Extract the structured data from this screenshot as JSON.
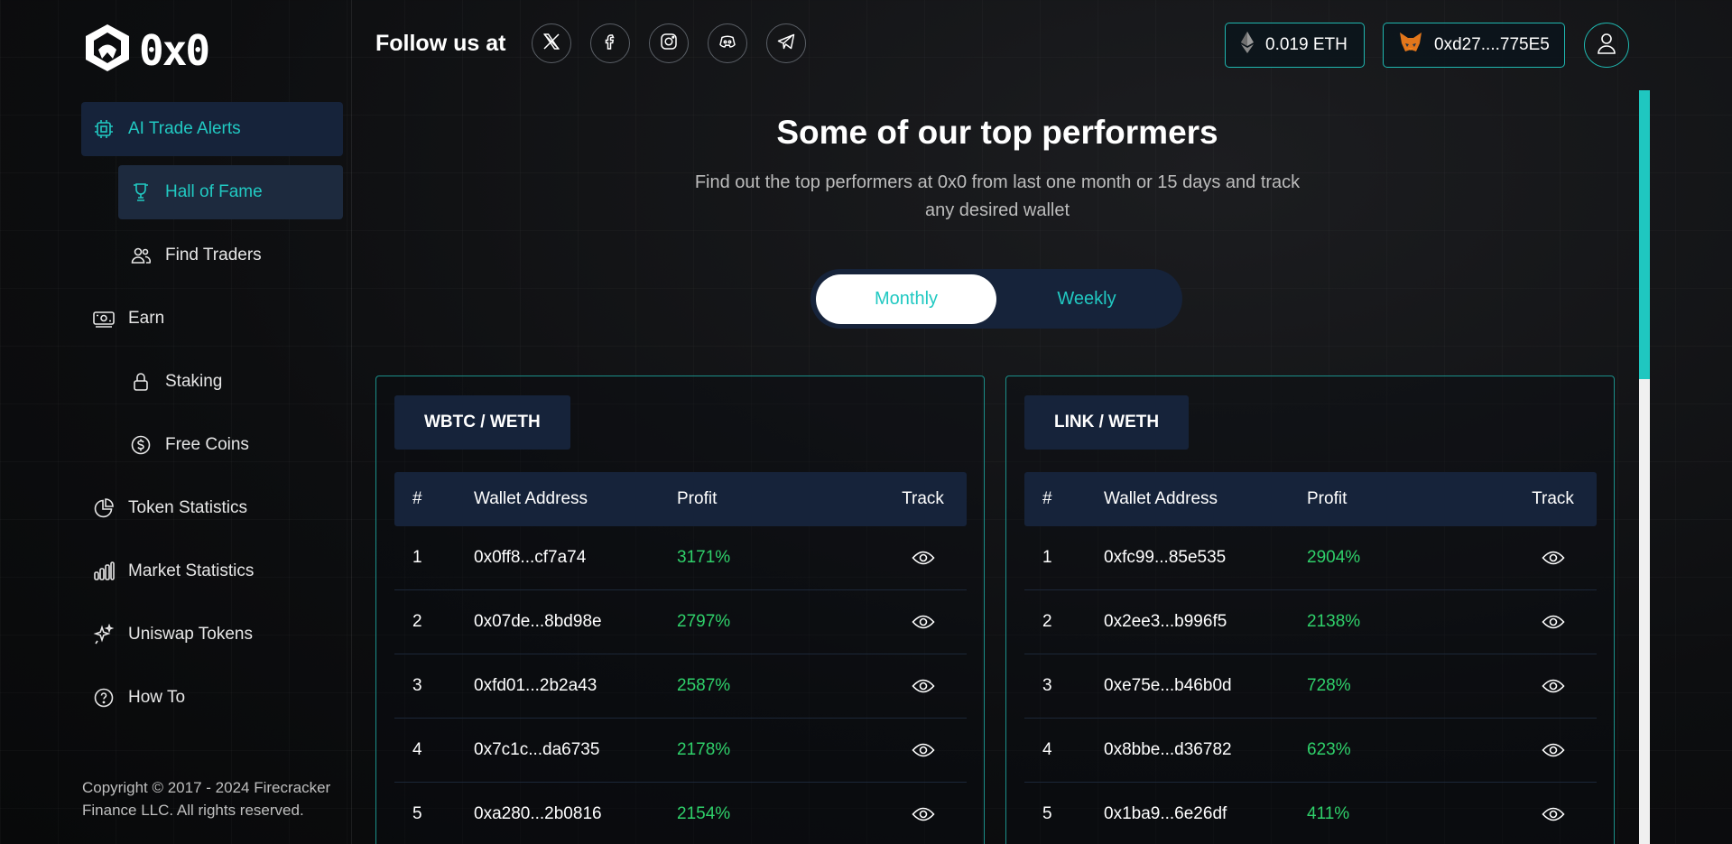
{
  "brand": {
    "name": "0x0"
  },
  "sidebar": {
    "items": [
      {
        "label": "AI Trade Alerts",
        "icon": "chip-icon",
        "state": "active"
      },
      {
        "label": "Hall of Fame",
        "icon": "trophy-icon",
        "state": "selected",
        "sub": true
      },
      {
        "label": "Find Traders",
        "icon": "users-icon",
        "sub": true
      },
      {
        "label": "Earn",
        "icon": "cash-icon"
      },
      {
        "label": "Staking",
        "icon": "lock-icon",
        "sub": true
      },
      {
        "label": "Free Coins",
        "icon": "coin-icon",
        "sub": true
      },
      {
        "label": "Token Statistics",
        "icon": "pie-chart-icon"
      },
      {
        "label": "Market Statistics",
        "icon": "bar-chart-icon"
      },
      {
        "label": "Uniswap Tokens",
        "icon": "sparkles-icon"
      },
      {
        "label": "How To",
        "icon": "help-icon"
      }
    ],
    "copyright": "Copyright © 2017 - 2024 Firecracker Finance LLC. All rights reserved."
  },
  "header": {
    "follow_label": "Follow us at",
    "socials": [
      "x-icon",
      "facebook-icon",
      "instagram-icon",
      "discord-icon",
      "telegram-icon"
    ],
    "eth_balance": "0.019 ETH",
    "wallet_address": "0xd27....775E5"
  },
  "main": {
    "title": "Some of our top performers",
    "subtitle": "Find out the top performers at 0x0 from last one month or 15 days and track any desired wallet",
    "toggle": {
      "monthly": "Monthly",
      "weekly": "Weekly",
      "selected": "Monthly"
    },
    "columns": {
      "num": "#",
      "wallet": "Wallet Address",
      "profit": "Profit",
      "track": "Track"
    },
    "tables": [
      {
        "pair": "WBTC / WETH",
        "rows": [
          {
            "num": "1",
            "wallet": "0x0ff8...cf7a74",
            "profit": "3171%"
          },
          {
            "num": "2",
            "wallet": "0x07de...8bd98e",
            "profit": "2797%"
          },
          {
            "num": "3",
            "wallet": "0xfd01...2b2a43",
            "profit": "2587%"
          },
          {
            "num": "4",
            "wallet": "0x7c1c...da6735",
            "profit": "2178%"
          },
          {
            "num": "5",
            "wallet": "0xa280...2b0816",
            "profit": "2154%"
          }
        ]
      },
      {
        "pair": "LINK / WETH",
        "rows": [
          {
            "num": "1",
            "wallet": "0xfc99...85e535",
            "profit": "2904%"
          },
          {
            "num": "2",
            "wallet": "0x2ee3...b996f5",
            "profit": "2138%"
          },
          {
            "num": "3",
            "wallet": "0xe75e...b46b0d",
            "profit": "728%"
          },
          {
            "num": "4",
            "wallet": "0x8bbe...d36782",
            "profit": "623%"
          },
          {
            "num": "5",
            "wallet": "0x1ba9...6e26df",
            "profit": "411%"
          }
        ]
      }
    ]
  },
  "colors": {
    "accent": "#21c9c2",
    "profit": "#2fd06a",
    "panel": "#16233a",
    "background": "#0b0c0e"
  }
}
